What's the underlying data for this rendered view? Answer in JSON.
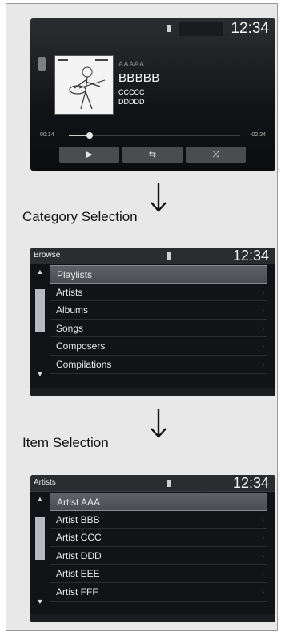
{
  "now_playing": {
    "clock": "12:34",
    "track": {
      "line1": "AAAAA",
      "line2": "BBBBB",
      "line3": "CCCCC",
      "line4": "DDDDD"
    },
    "elapsed": "00:14",
    "remaining": "-02:24",
    "progress": 0.12,
    "buttons": [
      {
        "icon": "play-icon",
        "glyph": "▶"
      },
      {
        "icon": "repeat-icon",
        "glyph": "⇆"
      },
      {
        "icon": "shuffle-icon",
        "glyph": "⤨"
      }
    ]
  },
  "labels": {
    "category": "Category Selection",
    "item": "Item Selection"
  },
  "category_list": {
    "title": "Browse",
    "clock": "12:34",
    "items": [
      {
        "label": "Playlists",
        "selected": true
      },
      {
        "label": "Artists",
        "selected": false
      },
      {
        "label": "Albums",
        "selected": false
      },
      {
        "label": "Songs",
        "selected": false
      },
      {
        "label": "Composers",
        "selected": false
      },
      {
        "label": "Compilations",
        "selected": false
      }
    ]
  },
  "item_list": {
    "title": "Artists",
    "clock": "12:34",
    "items": [
      {
        "label": "Artist AAA",
        "selected": true
      },
      {
        "label": "Artist BBB",
        "selected": false
      },
      {
        "label": "Artist CCC",
        "selected": false
      },
      {
        "label": "Artist DDD",
        "selected": false
      },
      {
        "label": "Artist EEE",
        "selected": false
      },
      {
        "label": "Artist FFF",
        "selected": false
      }
    ]
  },
  "colors": {
    "screen_bg": "#121316",
    "selected_row": "#55575c",
    "frame_bg": "#e8e8e8"
  }
}
